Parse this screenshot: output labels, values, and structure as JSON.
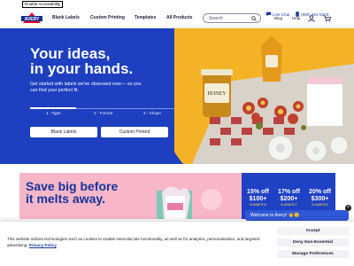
{
  "accessibility": {
    "label": "Enable Accessibility"
  },
  "header": {
    "brand": "AVERY",
    "nav": [
      "Blank Labels",
      "Custom Printing",
      "Templates",
      "All Products"
    ],
    "search_placeholder": "Search",
    "live_chat": "Live Chat",
    "phone": "(800) 462-8379",
    "blog": "Blog",
    "help": "Help"
  },
  "hero": {
    "title": "Your ideas,\nin your hands.",
    "subtitle": "Get started with labels we've obsessed over— so you can find your perfect fit.",
    "steps": [
      "1 - Type",
      "2 - Format",
      "3 - Shape"
    ],
    "buttons": [
      "Blank Labels",
      "Custom Printed"
    ]
  },
  "promo": {
    "title": "Save big before\nit melts away.",
    "offers": [
      {
        "pct": "15% off",
        "min": "$100+",
        "code": "SUMMER15"
      },
      {
        "pct": "17% off",
        "min": "$200+",
        "code": "SUMMER17"
      },
      {
        "pct": "20% off",
        "min": "$300+",
        "code": "SUMMER20"
      }
    ]
  },
  "chat": {
    "label": "Welcome to Avery! 👋😊"
  },
  "cookie": {
    "text": "This website utilizes technologies such as cookies to enable essential site functionality, as well as for analytics, personalization, and targeted advertising.",
    "link": "Privacy Policy",
    "buttons": [
      "Accept",
      "Deny Non-Essential",
      "Manage Preferences"
    ]
  },
  "colors": {
    "brand_blue": "#1e3fbf",
    "navy": "#1b1f3a",
    "promo_pink": "#f7b7c9"
  }
}
